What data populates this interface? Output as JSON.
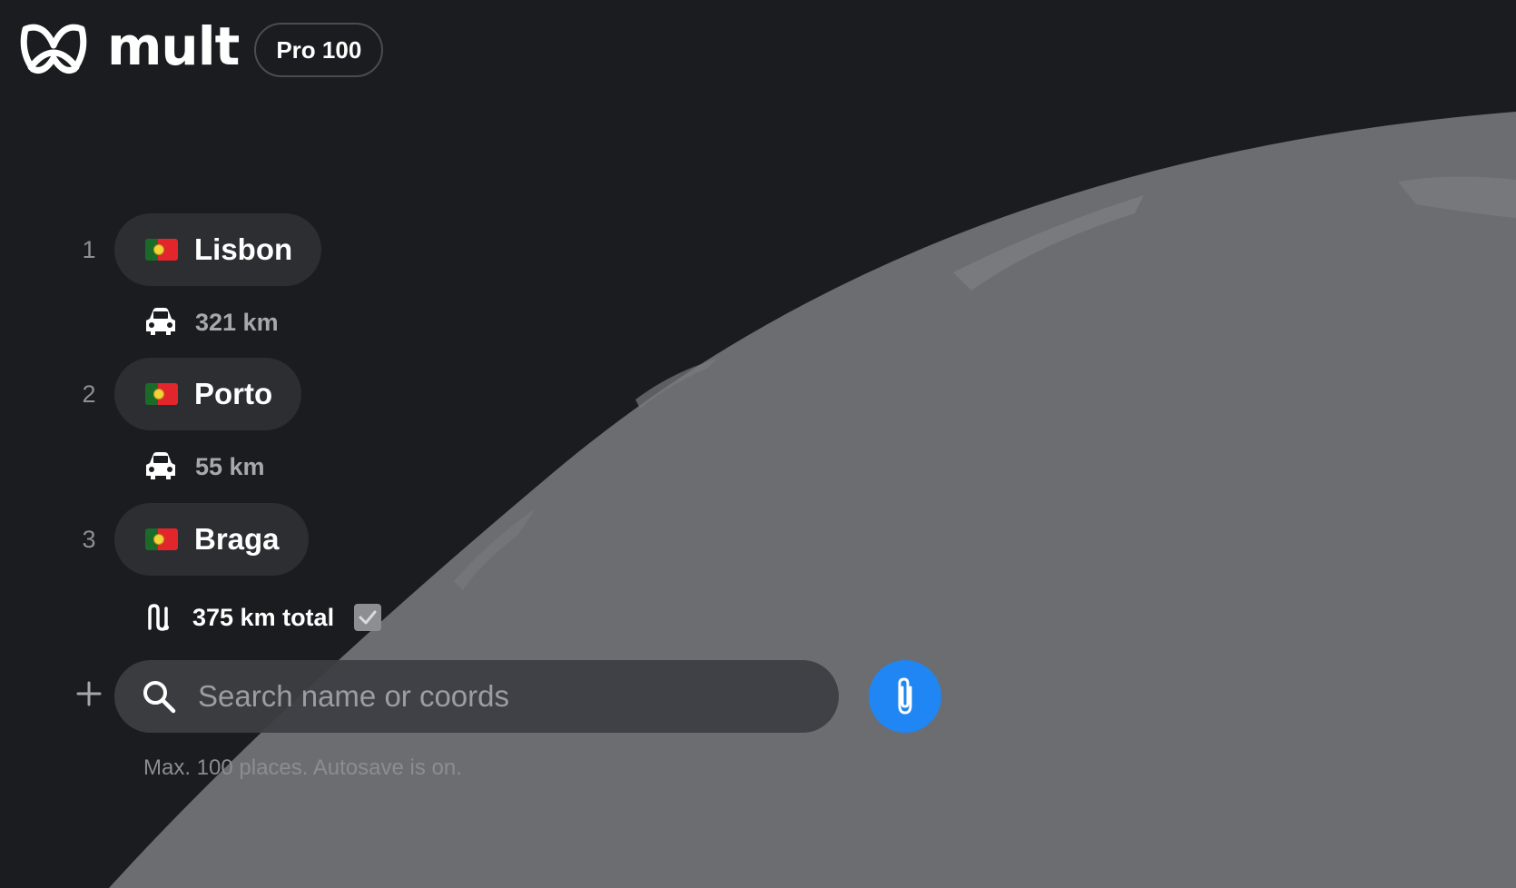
{
  "app": {
    "brand": "mult",
    "plan_badge": "Pro 100",
    "logo_icon": "mult-logo-icon"
  },
  "route": {
    "places": [
      {
        "index": "1",
        "name": "Lisbon",
        "flag": "portugal-flag"
      },
      {
        "index": "2",
        "name": "Porto",
        "flag": "portugal-flag"
      },
      {
        "index": "3",
        "name": "Braga",
        "flag": "portugal-flag"
      }
    ],
    "legs": [
      {
        "mode": "car-icon",
        "distance": "321 km"
      },
      {
        "mode": "car-icon",
        "distance": "55 km"
      }
    ],
    "total": {
      "icon": "route-icon",
      "text": "375 km total",
      "checked": true
    }
  },
  "search": {
    "placeholder": "Search name or coords",
    "value": ""
  },
  "footer": {
    "note": "Max. 100 places. Autosave is on."
  },
  "colors": {
    "background": "#1b1c1f",
    "globe": "#6d6e71",
    "chip": "#2d2e32",
    "accent": "#1f86f3"
  }
}
